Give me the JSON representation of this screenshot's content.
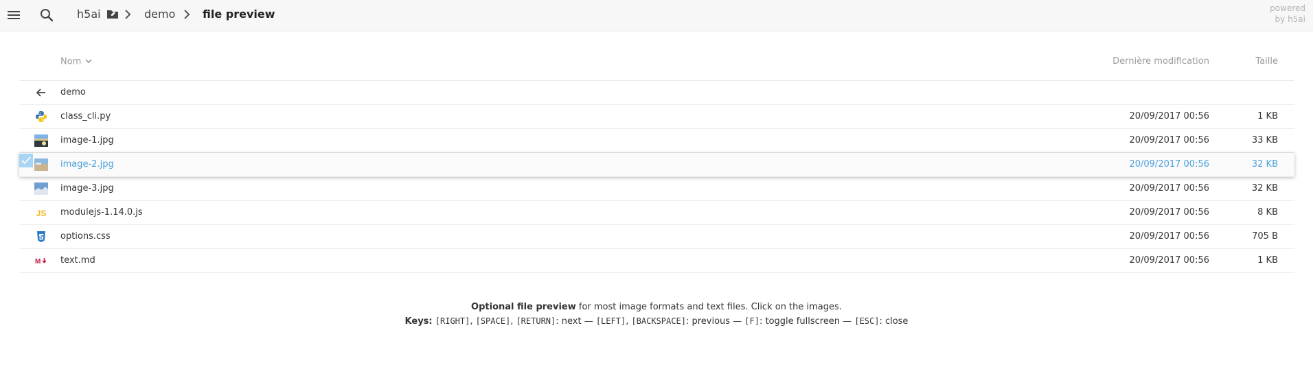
{
  "header": {
    "breadcrumb": [
      "h5ai",
      "demo",
      "file preview"
    ],
    "powered": [
      "powered",
      "by h5ai"
    ]
  },
  "columns": {
    "name": "Nom",
    "date": "Dernière modification",
    "size": "Taille"
  },
  "parent": {
    "name": "demo"
  },
  "files": [
    {
      "name": "class_cli.py",
      "date": "20/09/2017 00:56",
      "size": "1 KB",
      "icon": "python-icon"
    },
    {
      "name": "image-1.jpg",
      "date": "20/09/2017 00:56",
      "size": "33 KB",
      "icon": "image-thumbnail"
    },
    {
      "name": "image-2.jpg",
      "date": "20/09/2017 00:56",
      "size": "32 KB",
      "icon": "image-thumbnail",
      "selected": true
    },
    {
      "name": "image-3.jpg",
      "date": "20/09/2017 00:56",
      "size": "32 KB",
      "icon": "image-thumbnail"
    },
    {
      "name": "modulejs-1.14.0.js",
      "date": "20/09/2017 00:56",
      "size": "8 KB",
      "icon": "js-icon"
    },
    {
      "name": "options.css",
      "date": "20/09/2017 00:56",
      "size": "705 B",
      "icon": "css3-icon"
    },
    {
      "name": "text.md",
      "date": "20/09/2017 00:56",
      "size": "1 KB",
      "icon": "markdown-icon"
    }
  ],
  "info": {
    "line1_bold": "Optional file preview",
    "line1_rest": " for most image formats and text files. Click on the images.",
    "line2_bold": "Keys:",
    "keys": [
      {
        "text": " "
      },
      {
        "mono": "[RIGHT]"
      },
      {
        "text": ", "
      },
      {
        "mono": "[SPACE]"
      },
      {
        "text": ", "
      },
      {
        "mono": "[RETURN]"
      },
      {
        "text": ": next — "
      },
      {
        "mono": "[LEFT]"
      },
      {
        "text": ", "
      },
      {
        "mono": "[BACKSPACE]"
      },
      {
        "text": ": previous — "
      },
      {
        "mono": "[F]"
      },
      {
        "text": ": toggle fullscreen — "
      },
      {
        "mono": "[ESC]"
      },
      {
        "text": ": close"
      }
    ]
  },
  "colors": {
    "accent": "#4a9fde",
    "selection": "#a9d5f5",
    "topbar": "#f7f7f7"
  }
}
